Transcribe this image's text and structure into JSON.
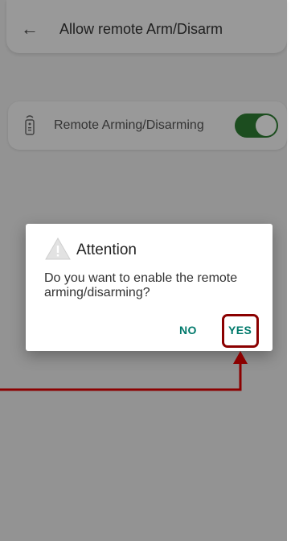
{
  "header": {
    "back_icon": "arrow-left-icon",
    "title": "Allow remote Arm/Disarm"
  },
  "setting": {
    "icon": "remote-control-icon",
    "label": "Remote Arming/Disarming",
    "enabled": true
  },
  "dialog": {
    "icon": "warning-icon",
    "title": "Attention",
    "message": "Do you want to enable the remote arming/disarming?",
    "no_label": "NO",
    "yes_label": "YES"
  },
  "annotation": {
    "color": "#8b0000",
    "target": "yes-button"
  },
  "colors": {
    "toggle_on": "#2e7d32",
    "dialog_button": "#00796b",
    "overlay": "rgba(0,0,0,0.38)"
  }
}
